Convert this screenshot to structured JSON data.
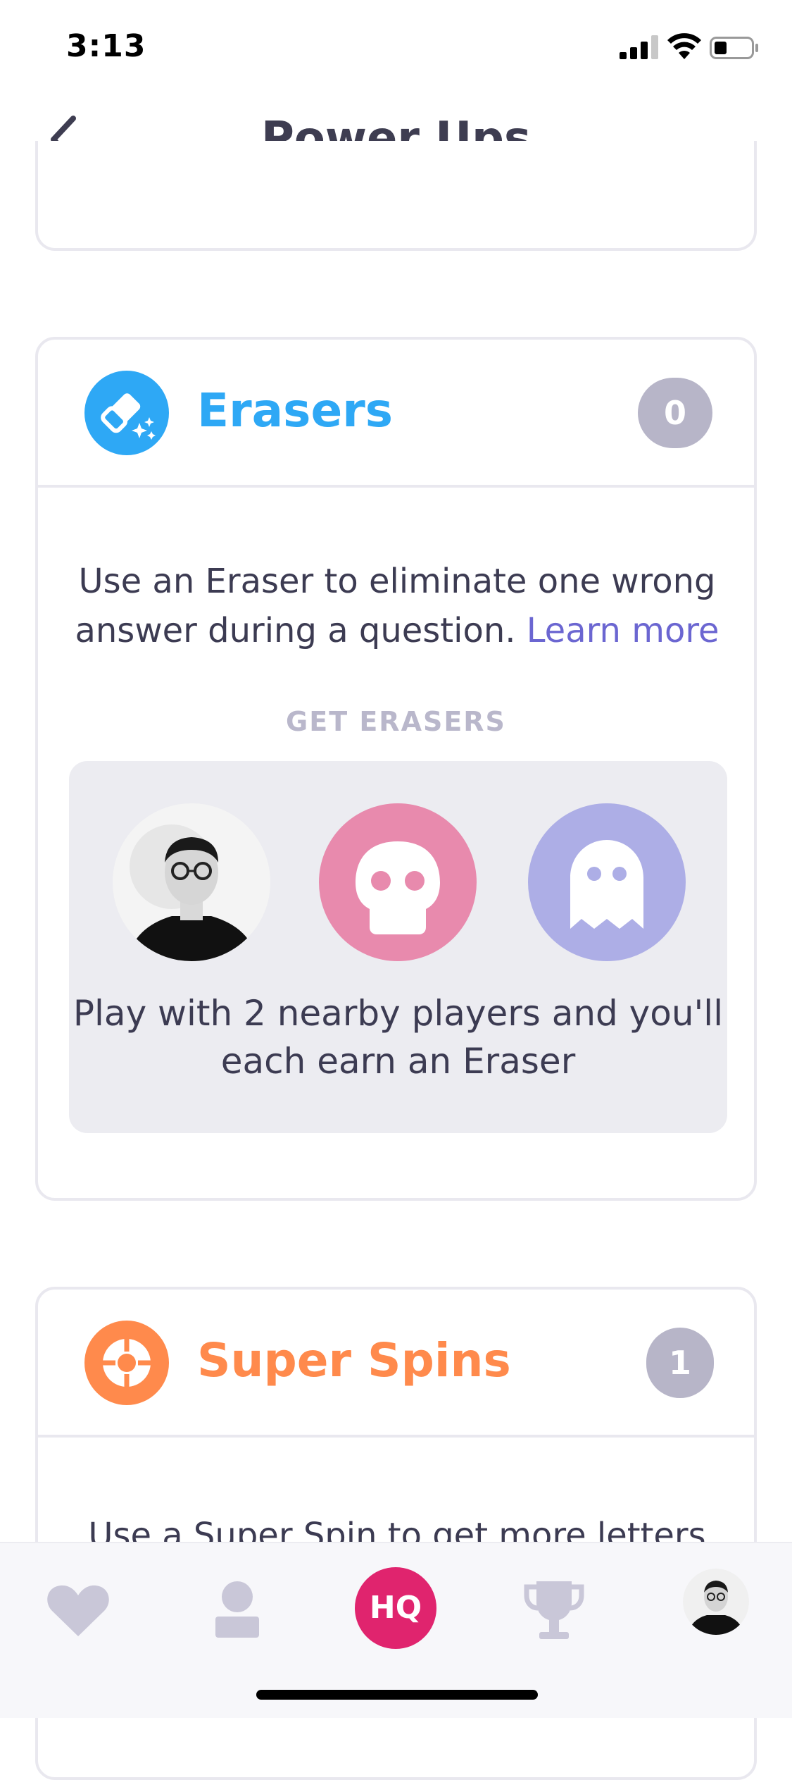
{
  "status_bar": {
    "time": "3:13"
  },
  "nav": {
    "title": "Power Ups"
  },
  "erasers": {
    "title": "Erasers",
    "count": "0",
    "description": "Use an Eraser to eliminate one wrong answer during a question.",
    "learn_more": "Learn more",
    "section_label": "GET ERASERS",
    "players_text": "Play with 2 nearby players and you'll each earn an Eraser",
    "accent_color": "#2ea8f5"
  },
  "super_spins": {
    "title": "Super Spins",
    "count": "1",
    "description": "Use a Super Spin to get more letters",
    "accent_color": "#ff8a4c"
  },
  "tabbar": {
    "hq_label": "HQ"
  },
  "colors": {
    "pink": "#e88aad",
    "lavender": "#adaee6",
    "hq": "#e0246e"
  }
}
